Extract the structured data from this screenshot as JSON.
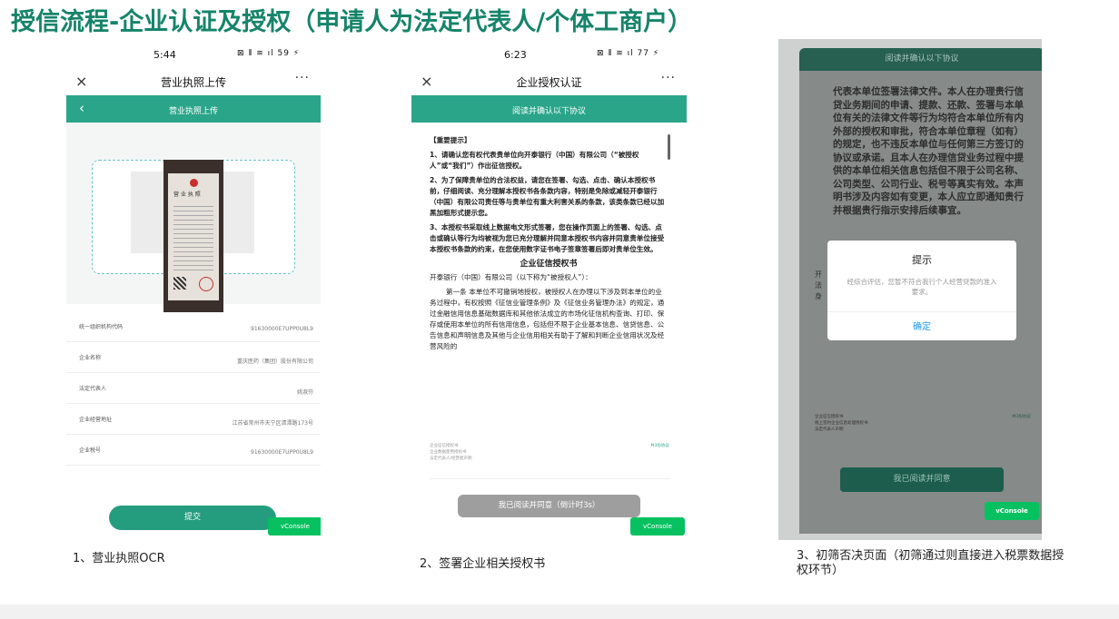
{
  "slide": {
    "title": "授信流程-企业认证及授权（申请人为法定代表人/个体工商户）"
  },
  "phone1": {
    "status": {
      "time": "5:44",
      "icons": "⊠ ⦀ ≋ ıl 59 ⚡"
    },
    "nav": {
      "close": "×",
      "title": "营业执照上传",
      "more": "···"
    },
    "header": {
      "back": "‹",
      "title": "营业执照上传"
    },
    "license_title": "营 业 执 照",
    "fields": [
      {
        "label": "统一组织机构代码",
        "value": "91630000E7UPP0U8L9"
      },
      {
        "label": "企业名称",
        "value": "重庆医药（集团）股份有限公司"
      },
      {
        "label": "法定代表人",
        "value": "姚淑芬"
      },
      {
        "label": "企业经营地址",
        "value": "江苏省常州市天宁区清潭路173号"
      },
      {
        "label": "企业税号",
        "value": "91630000E7UPP0U8L9"
      }
    ],
    "submit_label": "提交",
    "vconsole": "vConsole"
  },
  "phone2": {
    "status": {
      "time": "6:23",
      "icons": "⊠ ⦀ ≋ ıl 77 ⚡"
    },
    "nav": {
      "close": "×",
      "title": "企业授权认证",
      "more": "···"
    },
    "header": {
      "title": "阅读并确认以下协议"
    },
    "agreement": {
      "heading": "【重要提示】",
      "p1": "1、请确认您有权代表贵单位向开泰银行（中国）有限公司（“被授权人”或“我们”）作出征信授权。",
      "p2": "2、为了保障贵单位的合法权益，请您在签署、勾选、点击、确认本授权书前，仔细阅读、充分理解本授权书各条款内容，特别是免除或减轻开泰银行（中国）有限公司责任等与贵单位有重大利害关系的条款，该类条款已经以加黑加粗形式提示您。",
      "p3": "3、本授权书采取线上数据电文形式签署，您在操作页面上的签署、勾选、点击或确认等行为均被视为您已充分理解并同意本授权书内容并同意贵单位接受本授权书条款的约束，在您使用数字证书电子签章签署后即对贵单位生效。",
      "doc_title": "企业征信授权书",
      "p4": "开泰银行（中国）有限公司（以下称为“被授权人”）：",
      "p5": "第一条 本单位不可撤销地授权，被授权人在办理以下涉及到本单位的业务过程中，有权按照《征信业管理条例》及《征信业务管理办法》的规定，通过金融信用信息基础数据库和其他依法成立的市场化征信机构查询、打印、保存或使用本单位的所有信用信息，包括但不限于企业基本信息、信贷信息、公告信息和声明信息及其他与企业信用相关有助于了解和判断企业信用状况及经营风险的"
    },
    "links": [
      "企业征信授权书",
      "企业数据使用授权书",
      "法定代表人/经营者声明"
    ],
    "links_count": "共3份协议",
    "agree_label": "我已阅读并同意（倒计时3s）",
    "vconsole": "vConsole"
  },
  "phone3": {
    "header": "阅读并确认以下协议",
    "body_text": "代表本单位签署法律文件。本人在办理贵行信贷业务期间的申请、提款、还款、签署与本单位有关的法律文件等行为均符合本单位所有内外部的授权和审批，符合本单位章程（如有）的规定，也不违反本单位与任何第三方签订的协议或承诺。且本人在办理信贷业务过程中提供的本单位相关信息包括但不限于公司名称、公司类型、公司行业、税号等真实有效。本声明书涉及内容如有变更，本人应立即通知贵行并根据贵行指示安排后续事宜。",
    "side_text": [
      "开",
      "法",
      "身"
    ],
    "dialog": {
      "title": "提示",
      "message": "经综合评估，您暂不符合我行个人经营贷款的准入要求。",
      "button": "确定"
    },
    "links": [
      "企业征信授权书",
      "线上签约企业信息处理授权书",
      "法定代表人声明"
    ],
    "links_count": "共3份协议",
    "agree_label": "我已阅读并同意",
    "vconsole": "vConsole"
  },
  "captions": {
    "c1": "1、营业执照OCR",
    "c2": "2、签署企业相关授权书",
    "c3": "3、初筛否决页面（初筛通过则直接进入税票数据授权环节）"
  }
}
